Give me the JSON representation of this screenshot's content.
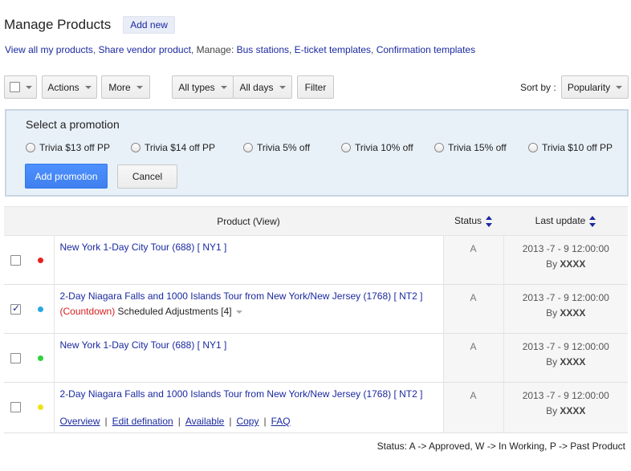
{
  "header": {
    "title": "Manage Products",
    "add_new": "Add new"
  },
  "nav": {
    "view_all": "View all my products",
    "share": "Share vendor product",
    "manage_label": "Manage:",
    "bus": "Bus stations",
    "eticket": "E-ticket templates",
    "confirm": "Confirmation templates"
  },
  "toolbar": {
    "actions": "Actions",
    "more": "More",
    "types": "All types",
    "days": "All days",
    "filter": "Filter",
    "sort_label": "Sort by :",
    "sort_value": "Popularity"
  },
  "promo": {
    "title": "Select a promotion",
    "options": [
      "Trivia $13 off PP",
      "Trivia $14 off PP",
      "Trivia 5% off",
      "Trivia 10% off",
      "Trivia 15% off",
      "Trivia $10 off PP"
    ],
    "add_button": "Add promotion",
    "cancel_button": "Cancel"
  },
  "table": {
    "headers": {
      "product": "Product (View)",
      "status": "Status",
      "updated": "Last update"
    },
    "rows": [
      {
        "checked": false,
        "dot_color": "#e8201f",
        "title": "New York 1-Day City Tour (688) [ NY1 ]",
        "status": "A",
        "date": "2013 -7 - 9  12:00:00",
        "by_label": "By",
        "by_user": "XXXX"
      },
      {
        "checked": true,
        "dot_color": "#2aa7e0",
        "title": "2-Day Niagara Falls and 1000 Islands Tour from New York/New Jersey (1768) [ NT2 ]",
        "countdown": "(Countdown)",
        "scheduled": "Scheduled Adjustments [4]",
        "status": "A",
        "date": "2013 -7 - 9  12:00:00",
        "by_label": "By",
        "by_user": "XXXX"
      },
      {
        "checked": false,
        "dot_color": "#2fd23a",
        "title": "New York 1-Day City Tour (688) [ NY1 ]",
        "status": "A",
        "date": "2013 -7 - 9  12:00:00",
        "by_label": "By",
        "by_user": "XXXX"
      },
      {
        "checked": false,
        "dot_color": "#efe21a",
        "title": "2-Day Niagara Falls and 1000 Islands Tour from New York/New Jersey (1768) [ NT2 ]",
        "status": "A",
        "date": "2013 -7 - 9  12:00:00",
        "by_label": "By",
        "by_user": "XXXX"
      }
    ],
    "row_actions": {
      "overview": "Overview",
      "edit": "Edit defination",
      "available": "Available",
      "copy": "Copy",
      "faq": "FAQ",
      "sep": "|"
    }
  },
  "legend": "Status: A -> Approved, W -> In Working, P -> Past Product"
}
